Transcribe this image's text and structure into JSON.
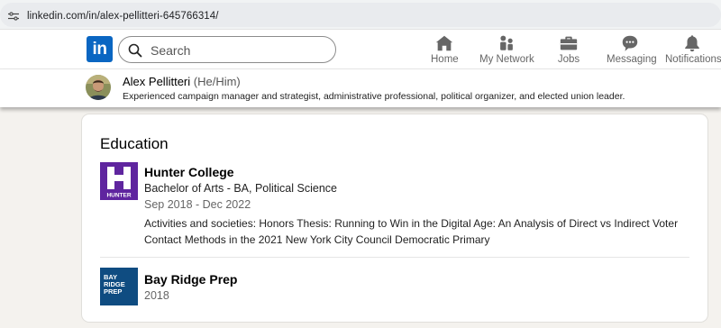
{
  "browser": {
    "url": "linkedin.com/in/alex-pellitteri-645766314/"
  },
  "nav": {
    "logo_text": "in",
    "search_placeholder": "Search",
    "items": [
      {
        "label": "Home",
        "icon": "home-icon"
      },
      {
        "label": "My Network",
        "icon": "network-icon"
      },
      {
        "label": "Jobs",
        "icon": "briefcase-icon"
      },
      {
        "label": "Messaging",
        "icon": "messaging-icon"
      },
      {
        "label": "Notifications",
        "icon": "bell-icon"
      }
    ]
  },
  "profile": {
    "name": "Alex Pellitteri",
    "pronouns": "(He/Him)",
    "headline": "Experienced campaign manager and strategist, administrative professional, political organizer, and elected union leader."
  },
  "education": {
    "title": "Education",
    "entries": [
      {
        "school": "Hunter College",
        "logo_text": "HUNTER",
        "degree": "Bachelor of Arts - BA, Political Science",
        "dates": "Sep 2018 - Dec 2022",
        "activities_line1": "Activities and societies: Honors Thesis: Running to Win in the Digital Age: An Analysis of Direct vs Indirect Voter",
        "activities_line2": "Contact Methods in the 2021 New York City Council Democratic Primary"
      },
      {
        "school": "Bay Ridge Prep",
        "logo_text": [
          "BAY",
          "RIDGE",
          "PREP"
        ],
        "dates": "2018"
      }
    ]
  },
  "colors": {
    "brand": "#0a66c2",
    "hunter_purple": "#5f259f",
    "bay_ridge_blue": "#0f4c81",
    "page_background": "#f4f2ee"
  }
}
